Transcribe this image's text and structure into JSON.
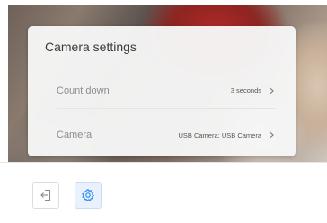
{
  "settings_panel": {
    "title": "Camera settings",
    "rows": [
      {
        "label": "Count down",
        "value": "3 seconds"
      },
      {
        "label": "Camera",
        "value": "USB Camera: USB Camera"
      }
    ]
  },
  "toolbar": {
    "buttons": [
      {
        "icon": "exit-icon"
      },
      {
        "icon": "gear-icon",
        "active": true
      }
    ]
  },
  "colors": {
    "accent": "#2d8cf0",
    "panel_bg": "#f6f6f6",
    "label": "#8d8d8d"
  }
}
